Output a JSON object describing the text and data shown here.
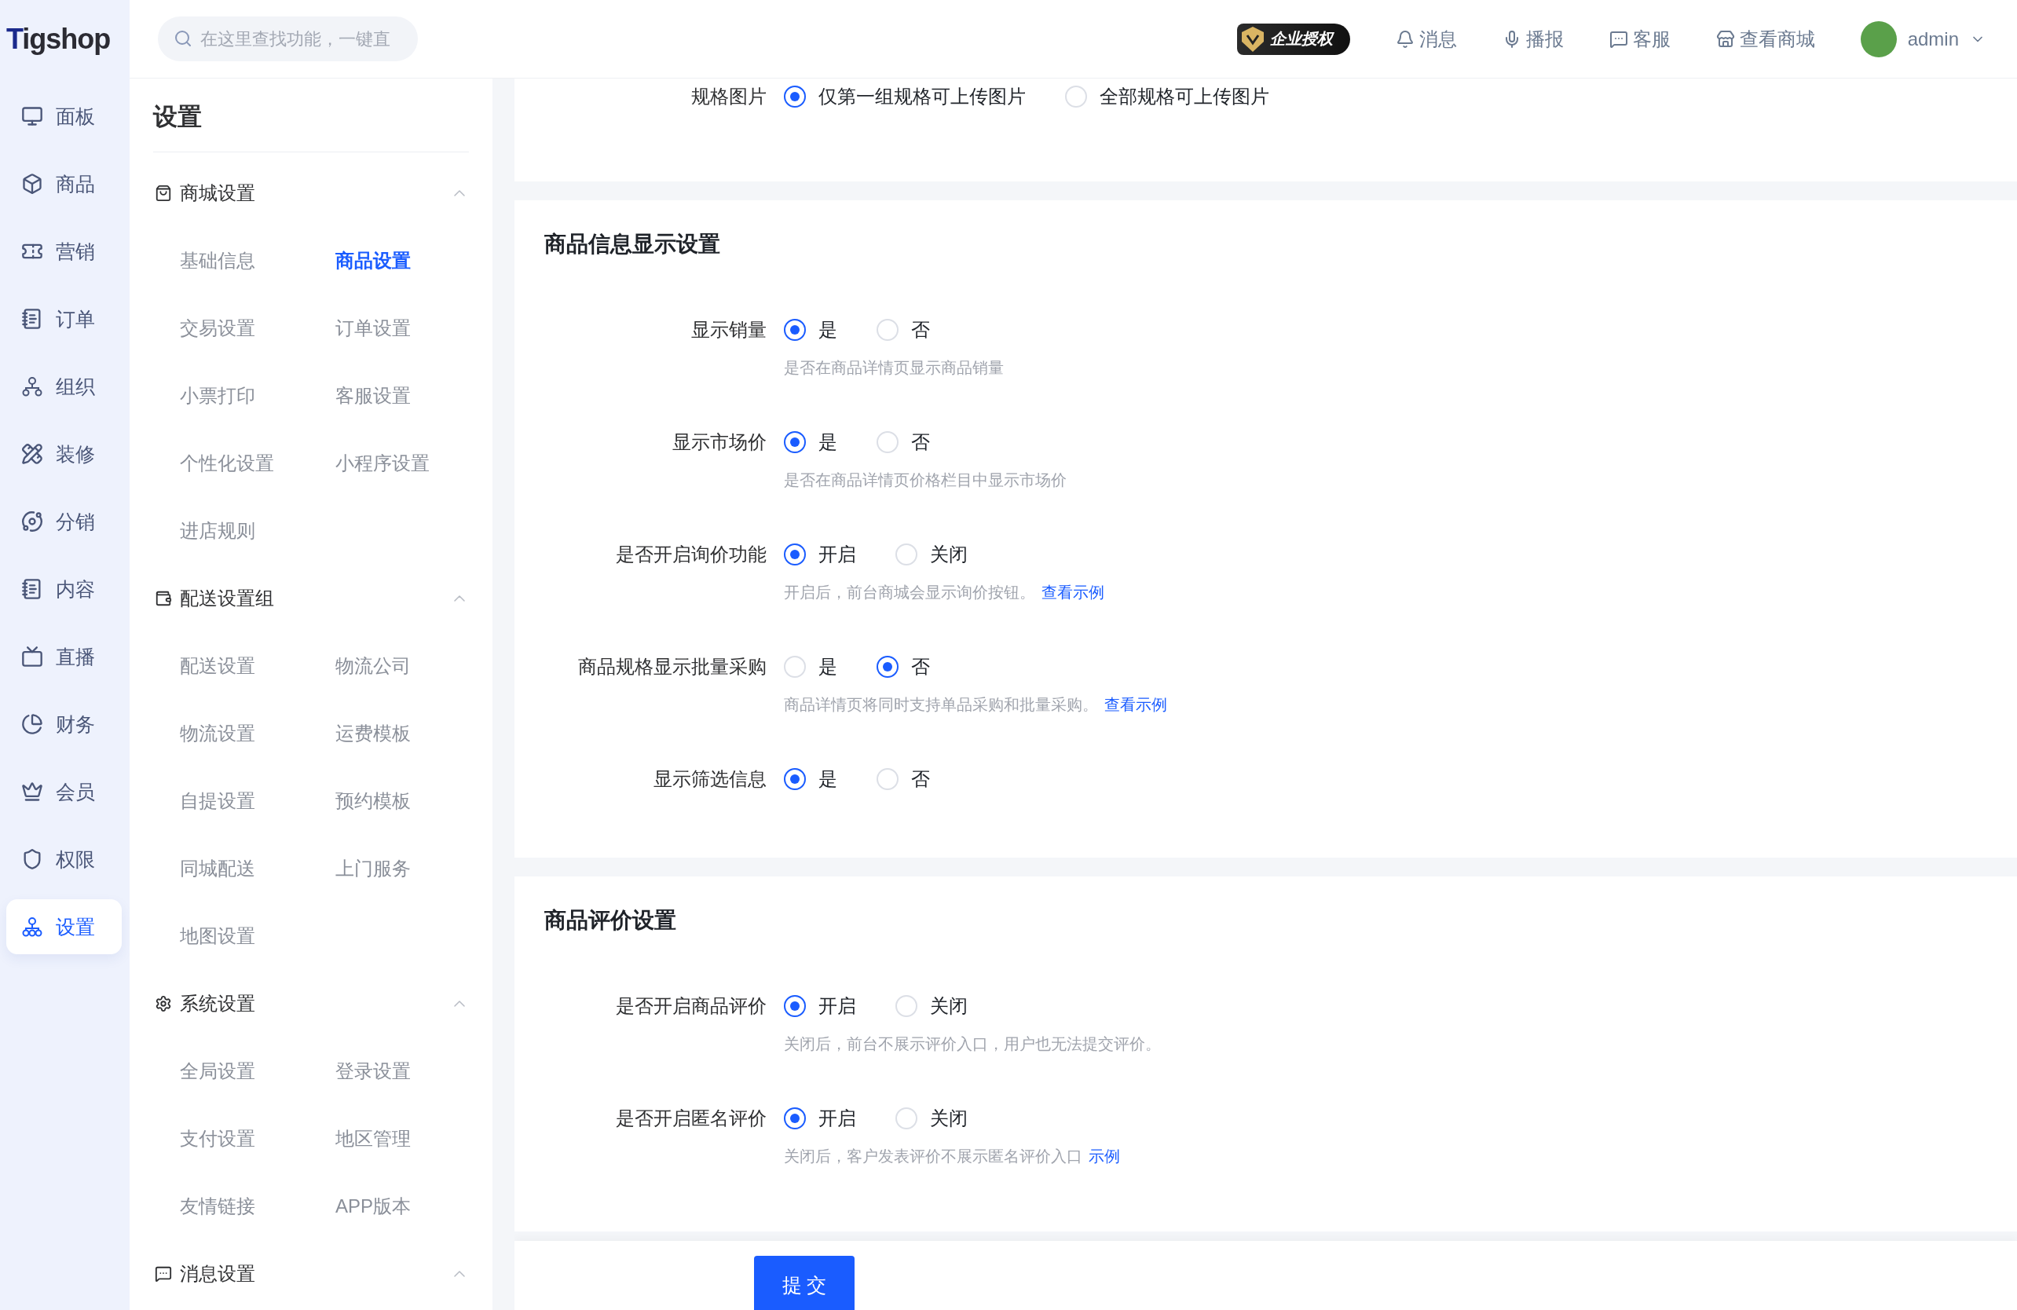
{
  "logo": {
    "text": "Tigshop"
  },
  "search": {
    "placeholder": "在这里查找功能，一键直"
  },
  "header_actions": [
    {
      "kind": "badge",
      "label": "企业授权"
    },
    {
      "kind": "link",
      "label": "消息"
    },
    {
      "kind": "link",
      "label": "播报"
    },
    {
      "kind": "link",
      "label": "客服"
    },
    {
      "kind": "link",
      "label": "查看商城"
    }
  ],
  "user": {
    "name": "admin"
  },
  "nav": [
    {
      "label": "面板",
      "selected": false
    },
    {
      "label": "商品",
      "selected": false
    },
    {
      "label": "营销",
      "selected": false
    },
    {
      "label": "订单",
      "selected": false
    },
    {
      "label": "组织",
      "selected": false
    },
    {
      "label": "装修",
      "selected": false
    },
    {
      "label": "分销",
      "selected": false
    },
    {
      "label": "内容",
      "selected": false
    },
    {
      "label": "直播",
      "selected": false
    },
    {
      "label": "财务",
      "selected": false
    },
    {
      "label": "会员",
      "selected": false
    },
    {
      "label": "权限",
      "selected": false
    },
    {
      "label": "设置",
      "selected": true
    }
  ],
  "settings_panel": {
    "title": "设置",
    "groups": [
      {
        "title": "商城设置",
        "expanded": true,
        "items": [
          {
            "label": "基础信息",
            "selected": false
          },
          {
            "label": "商品设置",
            "selected": true
          },
          {
            "label": "交易设置",
            "selected": false
          },
          {
            "label": "订单设置",
            "selected": false
          },
          {
            "label": "小票打印",
            "selected": false
          },
          {
            "label": "客服设置",
            "selected": false
          },
          {
            "label": "个性化设置",
            "selected": false
          },
          {
            "label": "小程序设置",
            "selected": false
          },
          {
            "label": "进店规则",
            "selected": false
          }
        ]
      },
      {
        "title": "配送设置组",
        "expanded": true,
        "items": [
          {
            "label": "配送设置",
            "selected": false
          },
          {
            "label": "物流公司",
            "selected": false
          },
          {
            "label": "物流设置",
            "selected": false
          },
          {
            "label": "运费模板",
            "selected": false
          },
          {
            "label": "自提设置",
            "selected": false
          },
          {
            "label": "预约模板",
            "selected": false
          },
          {
            "label": "同城配送",
            "selected": false
          },
          {
            "label": "上门服务",
            "selected": false
          },
          {
            "label": "地图设置",
            "selected": false
          }
        ]
      },
      {
        "title": "系统设置",
        "expanded": true,
        "items": [
          {
            "label": "全局设置",
            "selected": false
          },
          {
            "label": "登录设置",
            "selected": false
          },
          {
            "label": "支付设置",
            "selected": false
          },
          {
            "label": "地区管理",
            "selected": false
          },
          {
            "label": "友情链接",
            "selected": false
          },
          {
            "label": "APP版本",
            "selected": false
          }
        ]
      },
      {
        "title": "消息设置",
        "expanded": true
      }
    ]
  },
  "sections": [
    {
      "fields": [
        {
          "label": "规格图片",
          "options": [
            {
              "label": "仅第一组规格可上传图片",
              "selected": true
            },
            {
              "label": "全部规格可上传图片",
              "selected": false
            }
          ]
        }
      ]
    },
    {
      "title": "商品信息显示设置",
      "fields": [
        {
          "label": "显示销量",
          "options": [
            {
              "label": "是",
              "selected": true
            },
            {
              "label": "否",
              "selected": false
            }
          ],
          "hint": "是否在商品详情页显示商品销量"
        },
        {
          "label": "显示市场价",
          "options": [
            {
              "label": "是",
              "selected": true
            },
            {
              "label": "否",
              "selected": false
            }
          ],
          "hint": "是否在商品详情页价格栏目中显示市场价"
        },
        {
          "label": "是否开启询价功能",
          "options": [
            {
              "label": "开启",
              "selected": true
            },
            {
              "label": "关闭",
              "selected": false
            }
          ],
          "hint": "开启后，前台商城会显示询价按钮。",
          "link": "查看示例"
        },
        {
          "label": "商品规格显示批量采购",
          "options": [
            {
              "label": "是",
              "selected": false
            },
            {
              "label": "否",
              "selected": true
            }
          ],
          "hint": "商品详情页将同时支持单品采购和批量采购。",
          "link": "查看示例"
        },
        {
          "label": "显示筛选信息",
          "options": [
            {
              "label": "是",
              "selected": true
            },
            {
              "label": "否",
              "selected": false
            }
          ]
        }
      ]
    },
    {
      "title": "商品评价设置",
      "fields": [
        {
          "label": "是否开启商品评价",
          "options": [
            {
              "label": "开启",
              "selected": true
            },
            {
              "label": "关闭",
              "selected": false
            }
          ],
          "hint": "关闭后，前台不展示评价入口，用户也无法提交评价。"
        },
        {
          "label": "是否开启匿名评价",
          "options": [
            {
              "label": "开启",
              "selected": true
            },
            {
              "label": "关闭",
              "selected": false
            }
          ],
          "hint": "关闭后，客户发表评价不展示匿名评价入口",
          "link": "示例"
        }
      ]
    }
  ],
  "submit": {
    "label": "提 交"
  }
}
